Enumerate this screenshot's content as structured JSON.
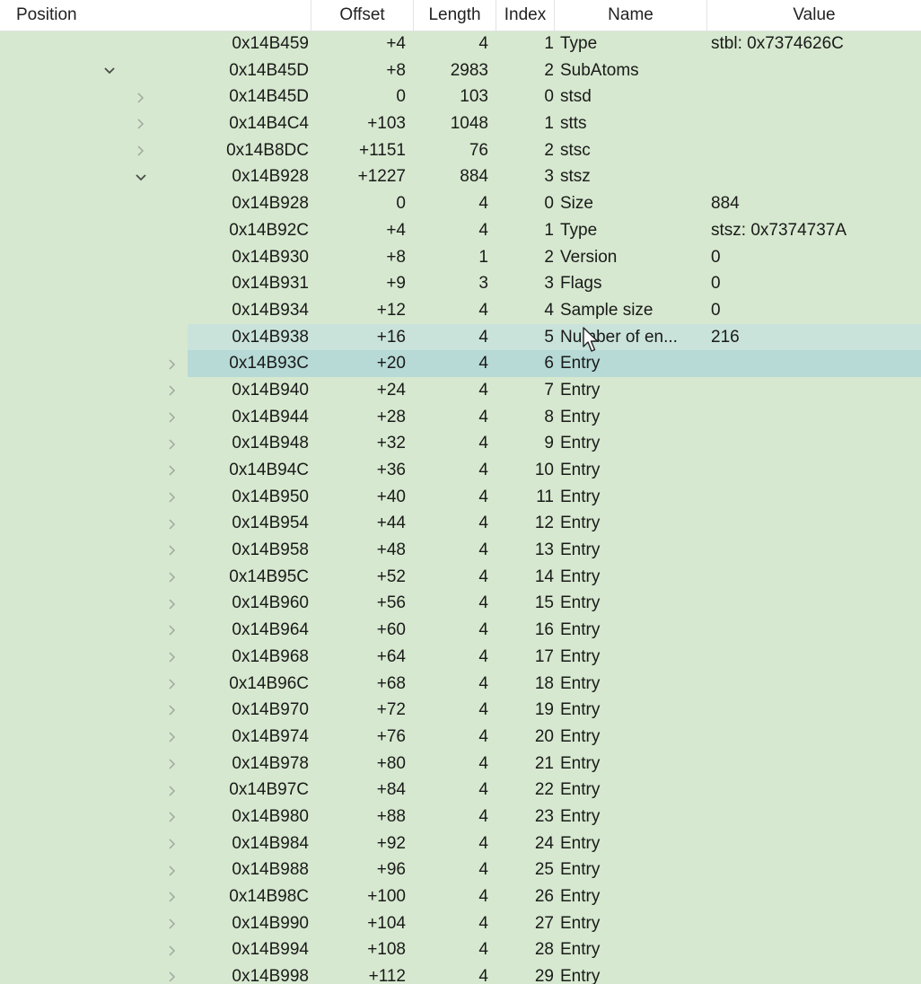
{
  "columns": {
    "position": "Position",
    "offset": "Offset",
    "length": "Length",
    "index": "Index",
    "name": "Name",
    "value": "Value"
  },
  "rows": [
    {
      "level": 0,
      "toggle": "none",
      "address": "0x14B459",
      "offset": "+4",
      "length": "4",
      "index": "1",
      "name": "Type",
      "value": "stbl: 0x7374626C"
    },
    {
      "level": 0,
      "toggle": "expanded",
      "address": "0x14B45D",
      "offset": "+8",
      "length": "2983",
      "index": "2",
      "name": "SubAtoms",
      "value": ""
    },
    {
      "level": 1,
      "toggle": "collapsed",
      "address": "0x14B45D",
      "offset": "0",
      "length": "103",
      "index": "0",
      "name": "stsd",
      "value": ""
    },
    {
      "level": 1,
      "toggle": "collapsed",
      "address": "0x14B4C4",
      "offset": "+103",
      "length": "1048",
      "index": "1",
      "name": "stts",
      "value": ""
    },
    {
      "level": 1,
      "toggle": "collapsed",
      "address": "0x14B8DC",
      "offset": "+1151",
      "length": "76",
      "index": "2",
      "name": "stsc",
      "value": ""
    },
    {
      "level": 1,
      "toggle": "expanded",
      "address": "0x14B928",
      "offset": "+1227",
      "length": "884",
      "index": "3",
      "name": "stsz",
      "value": ""
    },
    {
      "level": 2,
      "toggle": "none",
      "address": "0x14B928",
      "offset": "0",
      "length": "4",
      "index": "0",
      "name": "Size",
      "value": "884"
    },
    {
      "level": 2,
      "toggle": "none",
      "address": "0x14B92C",
      "offset": "+4",
      "length": "4",
      "index": "1",
      "name": "Type",
      "value": "stsz: 0x7374737A"
    },
    {
      "level": 2,
      "toggle": "none",
      "address": "0x14B930",
      "offset": "+8",
      "length": "1",
      "index": "2",
      "name": "Version",
      "value": "0"
    },
    {
      "level": 2,
      "toggle": "none",
      "address": "0x14B931",
      "offset": "+9",
      "length": "3",
      "index": "3",
      "name": "Flags",
      "value": "0"
    },
    {
      "level": 2,
      "toggle": "none",
      "address": "0x14B934",
      "offset": "+12",
      "length": "4",
      "index": "4",
      "name": "Sample size",
      "value": "0"
    },
    {
      "level": 2,
      "toggle": "none",
      "address": "0x14B938",
      "offset": "+16",
      "length": "4",
      "index": "5",
      "name": "Number of en...",
      "value": "216",
      "state": "hover"
    },
    {
      "level": 2,
      "toggle": "collapsed",
      "address": "0x14B93C",
      "offset": "+20",
      "length": "4",
      "index": "6",
      "name": "Entry",
      "value": "",
      "state": "selected"
    },
    {
      "level": 2,
      "toggle": "collapsed",
      "address": "0x14B940",
      "offset": "+24",
      "length": "4",
      "index": "7",
      "name": "Entry",
      "value": ""
    },
    {
      "level": 2,
      "toggle": "collapsed",
      "address": "0x14B944",
      "offset": "+28",
      "length": "4",
      "index": "8",
      "name": "Entry",
      "value": ""
    },
    {
      "level": 2,
      "toggle": "collapsed",
      "address": "0x14B948",
      "offset": "+32",
      "length": "4",
      "index": "9",
      "name": "Entry",
      "value": ""
    },
    {
      "level": 2,
      "toggle": "collapsed",
      "address": "0x14B94C",
      "offset": "+36",
      "length": "4",
      "index": "10",
      "name": "Entry",
      "value": ""
    },
    {
      "level": 2,
      "toggle": "collapsed",
      "address": "0x14B950",
      "offset": "+40",
      "length": "4",
      "index": "11",
      "name": "Entry",
      "value": ""
    },
    {
      "level": 2,
      "toggle": "collapsed",
      "address": "0x14B954",
      "offset": "+44",
      "length": "4",
      "index": "12",
      "name": "Entry",
      "value": ""
    },
    {
      "level": 2,
      "toggle": "collapsed",
      "address": "0x14B958",
      "offset": "+48",
      "length": "4",
      "index": "13",
      "name": "Entry",
      "value": ""
    },
    {
      "level": 2,
      "toggle": "collapsed",
      "address": "0x14B95C",
      "offset": "+52",
      "length": "4",
      "index": "14",
      "name": "Entry",
      "value": ""
    },
    {
      "level": 2,
      "toggle": "collapsed",
      "address": "0x14B960",
      "offset": "+56",
      "length": "4",
      "index": "15",
      "name": "Entry",
      "value": ""
    },
    {
      "level": 2,
      "toggle": "collapsed",
      "address": "0x14B964",
      "offset": "+60",
      "length": "4",
      "index": "16",
      "name": "Entry",
      "value": ""
    },
    {
      "level": 2,
      "toggle": "collapsed",
      "address": "0x14B968",
      "offset": "+64",
      "length": "4",
      "index": "17",
      "name": "Entry",
      "value": ""
    },
    {
      "level": 2,
      "toggle": "collapsed",
      "address": "0x14B96C",
      "offset": "+68",
      "length": "4",
      "index": "18",
      "name": "Entry",
      "value": ""
    },
    {
      "level": 2,
      "toggle": "collapsed",
      "address": "0x14B970",
      "offset": "+72",
      "length": "4",
      "index": "19",
      "name": "Entry",
      "value": ""
    },
    {
      "level": 2,
      "toggle": "collapsed",
      "address": "0x14B974",
      "offset": "+76",
      "length": "4",
      "index": "20",
      "name": "Entry",
      "value": ""
    },
    {
      "level": 2,
      "toggle": "collapsed",
      "address": "0x14B978",
      "offset": "+80",
      "length": "4",
      "index": "21",
      "name": "Entry",
      "value": ""
    },
    {
      "level": 2,
      "toggle": "collapsed",
      "address": "0x14B97C",
      "offset": "+84",
      "length": "4",
      "index": "22",
      "name": "Entry",
      "value": ""
    },
    {
      "level": 2,
      "toggle": "collapsed",
      "address": "0x14B980",
      "offset": "+88",
      "length": "4",
      "index": "23",
      "name": "Entry",
      "value": ""
    },
    {
      "level": 2,
      "toggle": "collapsed",
      "address": "0x14B984",
      "offset": "+92",
      "length": "4",
      "index": "24",
      "name": "Entry",
      "value": ""
    },
    {
      "level": 2,
      "toggle": "collapsed",
      "address": "0x14B988",
      "offset": "+96",
      "length": "4",
      "index": "25",
      "name": "Entry",
      "value": ""
    },
    {
      "level": 2,
      "toggle": "collapsed",
      "address": "0x14B98C",
      "offset": "+100",
      "length": "4",
      "index": "26",
      "name": "Entry",
      "value": ""
    },
    {
      "level": 2,
      "toggle": "collapsed",
      "address": "0x14B990",
      "offset": "+104",
      "length": "4",
      "index": "27",
      "name": "Entry",
      "value": ""
    },
    {
      "level": 2,
      "toggle": "collapsed",
      "address": "0x14B994",
      "offset": "+108",
      "length": "4",
      "index": "28",
      "name": "Entry",
      "value": ""
    },
    {
      "level": 2,
      "toggle": "collapsed",
      "address": "0x14B998",
      "offset": "+112",
      "length": "4",
      "index": "29",
      "name": "Entry",
      "value": ""
    }
  ],
  "colors": {
    "background": "#d6e8cf",
    "hover_row": "#c9e3db",
    "selected_row": "#b7dad6",
    "toggle_glyph": "#9aa39a"
  },
  "icons": {
    "expanded": "chevron-down-icon",
    "collapsed": "chevron-right-icon",
    "cursor": "mouse-pointer-icon"
  }
}
